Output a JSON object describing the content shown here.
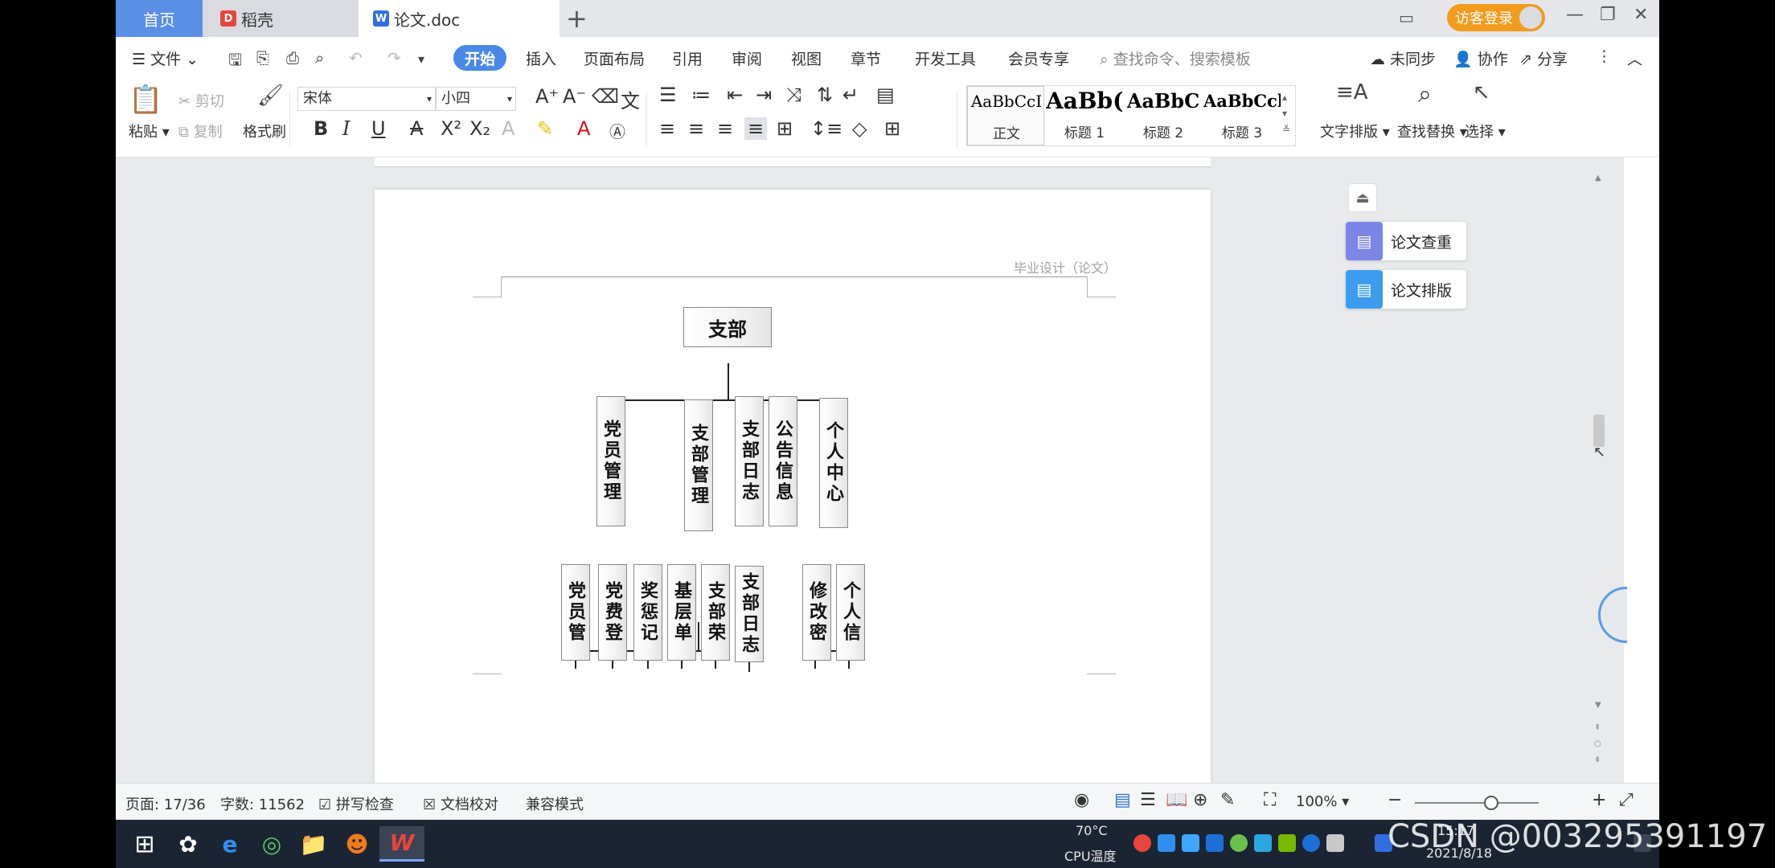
{
  "tabs": {
    "home": "首页",
    "daoke": "稻壳",
    "doc": "论文.doc",
    "new_tab": "+"
  },
  "titlebar": {
    "guest_login": "访客登录"
  },
  "menu": {
    "file": "文件",
    "items": [
      "开始",
      "插入",
      "页面布局",
      "引用",
      "审阅",
      "视图",
      "章节",
      "开发工具",
      "会员专享"
    ],
    "search_placeholder": "查找命令、搜索模板",
    "unsynced": "未同步",
    "collaborate": "协作",
    "share": "分享"
  },
  "ribbon": {
    "paste": "粘贴",
    "cut": "剪切",
    "copy": "复制",
    "format_painter": "格式刷",
    "font_name": "宋体",
    "font_size": "小四",
    "styles": [
      {
        "sample": "AaBbCcI",
        "name": "正文"
      },
      {
        "sample": "AaBb(",
        "name": "标题 1"
      },
      {
        "sample": "AaBbC",
        "name": "标题 2"
      },
      {
        "sample": "AaBbCcl",
        "name": "标题 3"
      }
    ],
    "text_layout": "文字排版",
    "find_replace": "查找替换",
    "select": "选择"
  },
  "document": {
    "header_text": "毕业设计（论文）",
    "org_chart": {
      "root": "支部",
      "level1": [
        "党员管理",
        "支部管理",
        "支部日志",
        "公告信息",
        "个人中心"
      ],
      "level2": [
        "党员管",
        "党费登",
        "奖惩记",
        "基层单",
        "支部荣",
        "支部日志",
        "修改密",
        "个人信"
      ]
    }
  },
  "side_panel": {
    "check": "论文查重",
    "layout": "论文排版"
  },
  "status": {
    "page": "页面: 17/36",
    "words": "字数: 11562",
    "spell_check": "拼写检查",
    "doc_proof": "文档校对",
    "compat_mode": "兼容模式",
    "zoom": "100%"
  },
  "taskbar": {
    "temp": "70°C",
    "cpu_label": "CPU温度",
    "time": "15:17",
    "date": "2021/8/18"
  },
  "watermark": "CSDN @003295391197",
  "colors": {
    "accent": "#4a88e8",
    "home_tab": "#5a8fe6",
    "guest_btn": "#f29b1c",
    "taskbar": "#1a2433"
  }
}
